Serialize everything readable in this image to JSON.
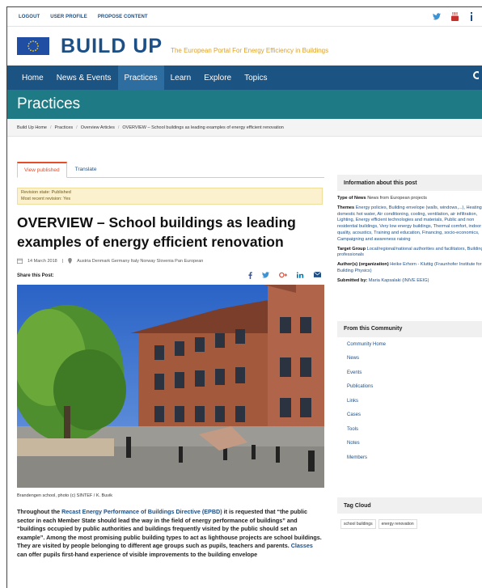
{
  "topbar": {
    "links": [
      "LOGOUT",
      "USER PROFILE",
      "PROPOSE CONTENT"
    ],
    "social_icons": [
      "twitter-icon",
      "youtube-icon",
      "linkedin-icon"
    ]
  },
  "brand": {
    "title": "BUILD UP",
    "tagline": "The European Portal For Energy Efficiency in Buildings"
  },
  "nav": {
    "items": [
      "Home",
      "News & Events",
      "Practices",
      "Learn",
      "Explore",
      "Topics"
    ],
    "active": "Practices"
  },
  "hero": {
    "title": "Practices"
  },
  "breadcrumb": [
    "Build Up Home",
    "Practices",
    "Overview Articles",
    "OVERVIEW – School buildings as leading examples of energy efficient renovation"
  ],
  "tabs": [
    "View published",
    "Translate"
  ],
  "revision": {
    "state": "Revision state: Published",
    "recent": "Most recent revision: Yes"
  },
  "article": {
    "title": "OVERVIEW – School buildings as leading examples of energy efficient renovation",
    "date": "14 March 2018",
    "countries": "Austria Denmark Germany Italy Norway Slovenia Pan European",
    "share_label": "Share this Post:",
    "caption": "Brandengen school, photo (c) SINTEF / K. Buvik",
    "body_start": "Throughout the ",
    "body_link": "Recast Energy Performance of Buildings Directive (EPBD)",
    "body_mid": " it is requested that “the public sector in each Member State should lead the way in the field of energy performance of buildings” and “buildings occupied by public authorities and buildings frequently visited by the public should set an example”. Among the most promising public building types to act as lighthouse projects are school buildings. They are visited by people belonging to different age groups such as pupils, teachers and parents. ",
    "body_link2": "Classes",
    "body_end": " can offer pupils first-hand experience of visible improvements to the building envelope"
  },
  "info": {
    "header": "Information about this post",
    "type_label": "Type of News",
    "type_value": "News from European projects",
    "themes_label": "Themes",
    "themes_value": "Energy policies, Building envelope (walls, windows,...), Heating, domestic hot water, Air conditioning, cooling, ventilation, air infiltration, Lighting, Energy efficient technologies and materials, Public and non residential buildings, Very low energy buildings, Thermal comfort, indoor air quality, acoustics, Training and education, Financing, socio-economics, Campaigning and awareness raising",
    "target_label": "Target Group",
    "target_value": "Local/regional/national authorities and facilitators, Building professionals",
    "author_label": "Author(s) (organization)",
    "author_value": "Heike Erhorn - Kluttig (Fraunhofer Institute for Building Physics)",
    "submitted_label": "Submitted by:",
    "submitted_value": "Maria Kapsalaki (INIVE EEIG)"
  },
  "community": {
    "header": "From this Community",
    "items": [
      "Community Home",
      "News",
      "Events",
      "Publications",
      "Links",
      "Cases",
      "Tools",
      "Notes",
      "Members"
    ]
  },
  "tagcloud": {
    "header": "Tag Cloud",
    "tags": [
      "school buildings",
      "energy renovation"
    ]
  },
  "colors": {
    "brand_blue": "#1c4f86",
    "nav_bg": "#1b5383",
    "hero_bg": "#1e7b86",
    "accent": "#e34d2a",
    "tagline": "#e0a020"
  }
}
